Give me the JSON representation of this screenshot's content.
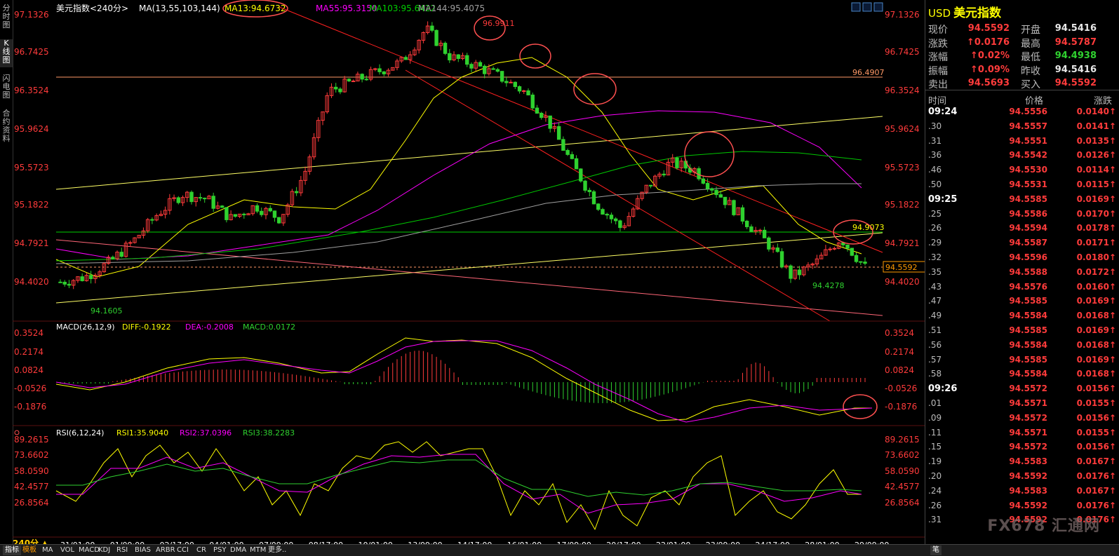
{
  "left_tabs": [
    "分时图",
    "K线图",
    "闪电图",
    "合约资料"
  ],
  "main_legend": {
    "title": "美元指数<240分>",
    "ma": "MA(13,55,103,144)",
    "ma13": "MA13:94.6732",
    "ma55": "MA55:95.3150",
    "ma103": "MA103:95.6422",
    "ma144": "MA144:95.4075"
  },
  "price_axis": [
    "97.1326",
    "96.7425",
    "96.3524",
    "95.9624",
    "95.5723",
    "95.1822",
    "94.7921",
    "94.4020"
  ],
  "price_range": [
    94.16,
    97.2
  ],
  "annotations": {
    "high": "96.9911",
    "low": "94.1605",
    "low2": "94.4278",
    "hline1": "96.4907",
    "hline2": "94.9073",
    "last_price": "94.5592"
  },
  "macd_legend": {
    "name": "MACD(26,12,9)",
    "diff": "DIFF:-0.1922",
    "dea": "DEA:-0.2008",
    "macd": "MACD:0.0172"
  },
  "macd_axis": [
    "0.3524",
    "0.2174",
    "0.0824",
    "-0.0526",
    "-0.1876"
  ],
  "rsi_legend": {
    "name": "RSI(6,12,24)",
    "rsi1": "RSI1:35.9040",
    "rsi2": "RSI2:37.0396",
    "rsi3": "RSI3:38.2283"
  },
  "rsi_axis": [
    "89.2615",
    "73.6602",
    "58.0590",
    "42.4577",
    "26.8564"
  ],
  "date_axis": [
    "31/01:00",
    "01/09:00",
    "02/17:00",
    "04/01:00",
    "07/09:00",
    "08/17:00",
    "10/01:00",
    "13/09:00",
    "14/17:00",
    "16/01:00",
    "17/09:00",
    "20/17:00",
    "22/01:00",
    "23/09:00",
    "24/17:00",
    "28/01:00",
    "29/09:00"
  ],
  "period_label": "240分 ▲",
  "quote": {
    "code": "USD",
    "name": "美元指数",
    "rows": [
      {
        "l1": "现价",
        "v1": "94.5592",
        "c1": "red",
        "l2": "开盘",
        "v2": "94.5416",
        "c2": "white"
      },
      {
        "l1": "涨跌",
        "v1": "↑0.0176",
        "c1": "red",
        "l2": "最高",
        "v2": "94.5787",
        "c2": "red"
      },
      {
        "l1": "涨幅",
        "v1": "↑0.02%",
        "c1": "red",
        "l2": "最低",
        "v2": "94.4938",
        "c2": "green"
      },
      {
        "l1": "振幅",
        "v1": "↑0.09%",
        "c1": "red",
        "l2": "昨收",
        "v2": "94.5416",
        "c2": "white"
      },
      {
        "l1": "卖出",
        "v1": "94.5693",
        "c1": "red",
        "l2": "买入",
        "v2": "94.5592",
        "c2": "red"
      }
    ]
  },
  "ticks_header": {
    "time": "时间",
    "price": "价格",
    "change": "涨跌"
  },
  "ticks": [
    {
      "t": "09:24",
      "p": "94.5556",
      "c": "0.0140↑"
    },
    {
      "t": ".30",
      "p": "94.5557",
      "c": "0.0141↑"
    },
    {
      "t": ".31",
      "p": "94.5551",
      "c": "0.0135↑"
    },
    {
      "t": ".36",
      "p": "94.5542",
      "c": "0.0126↑"
    },
    {
      "t": ".46",
      "p": "94.5530",
      "c": "0.0114↑"
    },
    {
      "t": ".50",
      "p": "94.5531",
      "c": "0.0115↑"
    },
    {
      "t": "09:25",
      "p": "94.5585",
      "c": "0.0169↑"
    },
    {
      "t": ".25",
      "p": "94.5586",
      "c": "0.0170↑"
    },
    {
      "t": ".26",
      "p": "94.5594",
      "c": "0.0178↑"
    },
    {
      "t": ".29",
      "p": "94.5587",
      "c": "0.0171↑"
    },
    {
      "t": ".32",
      "p": "94.5596",
      "c": "0.0180↑"
    },
    {
      "t": ".35",
      "p": "94.5588",
      "c": "0.0172↑"
    },
    {
      "t": ".43",
      "p": "94.5576",
      "c": "0.0160↑"
    },
    {
      "t": ".47",
      "p": "94.5585",
      "c": "0.0169↑"
    },
    {
      "t": ".49",
      "p": "94.5584",
      "c": "0.0168↑"
    },
    {
      "t": ".51",
      "p": "94.5585",
      "c": "0.0169↑"
    },
    {
      "t": ".56",
      "p": "94.5584",
      "c": "0.0168↑"
    },
    {
      "t": ".57",
      "p": "94.5585",
      "c": "0.0169↑"
    },
    {
      "t": ".58",
      "p": "94.5584",
      "c": "0.0168↑"
    },
    {
      "t": "09:26",
      "p": "94.5572",
      "c": "0.0156↑"
    },
    {
      "t": ".01",
      "p": "94.5571",
      "c": "0.0155↑"
    },
    {
      "t": ".09",
      "p": "94.5572",
      "c": "0.0156↑"
    },
    {
      "t": ".11",
      "p": "94.5571",
      "c": "0.0155↑"
    },
    {
      "t": ".15",
      "p": "94.5572",
      "c": "0.0156↑"
    },
    {
      "t": ".19",
      "p": "94.5583",
      "c": "0.0167↑"
    },
    {
      "t": ".20",
      "p": "94.5592",
      "c": "0.0176↑"
    },
    {
      "t": ".24",
      "p": "94.5583",
      "c": "0.0167↑"
    },
    {
      "t": ".26",
      "p": "94.5592",
      "c": "0.0176↑"
    },
    {
      "t": ".31",
      "p": "94.5592",
      "c": "0.0176↑"
    }
  ],
  "bottom_tabs": [
    "指标",
    "模板",
    "MA",
    "VOL",
    "MACD",
    "KDJ",
    "RSI",
    "BIAS",
    "ARBR",
    "CCI",
    "CR",
    "PSY",
    "DMA",
    "MTM",
    "更多.."
  ],
  "right_bottom_tab": "笔",
  "watermark": "FX678 汇通网",
  "colors": {
    "up": "#ff3b3b",
    "down": "#2fd12f",
    "ma13": "#ffff00",
    "ma55": "#ff00ff",
    "ma103": "#00c800",
    "ma144": "#a0a0a0",
    "hline": "#ff9966",
    "channel_red": "#ff2020",
    "trend_yellow": "#ffff66",
    "circle": "#ff5050"
  },
  "chart_data": {
    "type": "candlestick",
    "x_labels": [
      "31/01:00",
      "01/09:00",
      "02/17:00",
      "04/01:00",
      "07/09:00",
      "08/17:00",
      "10/01:00",
      "13/09:00",
      "14/17:00",
      "16/01:00",
      "17/09:00",
      "20/17:00",
      "22/01:00",
      "23/09:00",
      "24/17:00",
      "28/01:00",
      "29/09:00"
    ],
    "close_path": [
      94.4,
      94.45,
      94.6,
      94.82,
      95.1,
      95.3,
      95.25,
      95.05,
      95.18,
      95.05,
      95.5,
      96.35,
      96.45,
      96.55,
      96.65,
      96.99,
      96.7,
      96.62,
      96.5,
      96.35,
      96.05,
      95.6,
      95.2,
      94.95,
      95.35,
      95.62,
      95.55,
      95.3,
      95.05,
      94.8,
      94.45,
      94.6,
      94.85,
      94.55
    ]
  }
}
